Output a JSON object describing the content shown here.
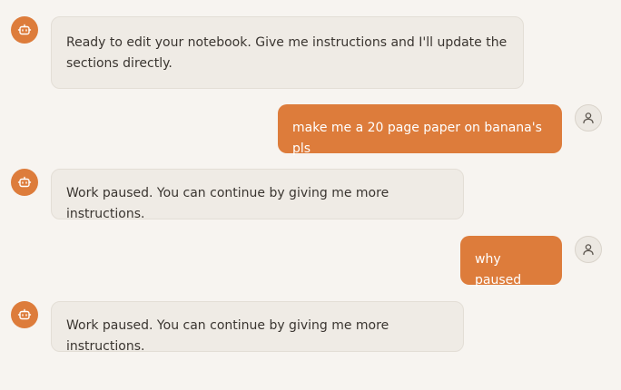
{
  "colors": {
    "background": "#f7f4f0",
    "accent": "#dd7c3b",
    "assistant_bubble": "#efebe5",
    "user_avatar_bg": "#ece8e2"
  },
  "messages": [
    {
      "role": "assistant",
      "icon": "bot-icon",
      "text": "Ready to edit your notebook. Give me instructions and I'll update the sections directly."
    },
    {
      "role": "user",
      "icon": "user-icon",
      "text": "make me a 20 page paper on banana's pls"
    },
    {
      "role": "assistant",
      "icon": "bot-icon",
      "text": "Work paused. You can continue by giving me more instructions."
    },
    {
      "role": "user",
      "icon": "user-icon",
      "text": "why paused"
    },
    {
      "role": "assistant",
      "icon": "bot-icon",
      "text": "Work paused. You can continue by giving me more instructions."
    }
  ]
}
